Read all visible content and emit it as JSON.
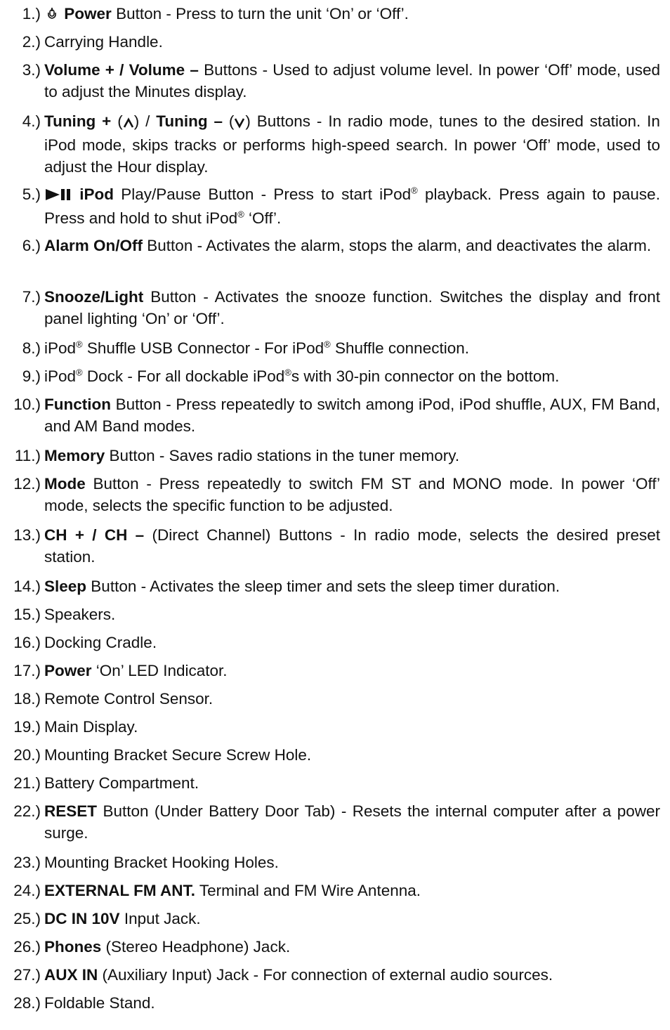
{
  "items": [
    {
      "num": "1.)",
      "bold": "Power",
      "text": "Button - Press to turn the unit ‘On’ or ‘Off’."
    },
    {
      "num": "2.)",
      "text": "Carrying Handle."
    },
    {
      "num": "3.)",
      "bold": "Volume + / Volume –",
      "text": "Buttons - Used to adjust volume level. In power ‘Off’ mode, used to adjust the Minutes display."
    },
    {
      "num": "4.)",
      "bold1": "Tuning +",
      "sym1": "(",
      "sym1b": ")",
      "sep": "/",
      "bold2": "Tuning –",
      "text": "Buttons - In radio mode, tunes to the desired station. In iPod mode, skips tracks or performs high-speed search. In power ‘Off’ mode, used to adjust the Hour display."
    },
    {
      "num": "5.)",
      "bold": "iPod",
      "pre": "Play/Pause Button - Press to start iPod",
      "mid": "playback. Press again to pause. Press and hold to shut iPod",
      "post": "‘Off’.",
      "reg": "®"
    },
    {
      "num": "6.)",
      "bold": "Alarm On/Off",
      "text": "Button - Activates the alarm, stops the alarm, and deactivates the alarm."
    },
    {
      "num": "7.)",
      "bold": "Snooze/Light",
      "text": "Button - Activates the snooze function. Switches the display and front panel lighting ‘On’ or ‘Off’."
    },
    {
      "num": "8.)",
      "pre": "iPod",
      "mid": "Shuffle USB Connector - For iPod",
      "post": "Shuffle connection.",
      "reg": "®"
    },
    {
      "num": "9.)",
      "pre": "iPod",
      "mid": "Dock - For all dockable iPod",
      "post": "s with 30-pin connector on the bottom.",
      "reg": "®"
    },
    {
      "num": "10.)",
      "bold": "Function",
      "text": "Button - Press repeatedly to switch among iPod, iPod shuffle, AUX, FM Band, and AM Band modes."
    },
    {
      "num": "11.)",
      "bold": "Memory",
      "text": "Button - Saves radio stations in the tuner memory."
    },
    {
      "num": "12.)",
      "bold": "Mode",
      "text": "Button - Press repeatedly to switch FM ST and MONO mode. In power ‘Off’ mode, selects the specific function to be adjusted."
    },
    {
      "num": "13.)",
      "bold": "CH + / CH –",
      "text": "(Direct Channel) Buttons - In radio mode, selects the desired preset station."
    },
    {
      "num": "14.)",
      "bold": "Sleep",
      "text": "Button - Activates the sleep timer and sets the sleep timer duration."
    },
    {
      "num": "15.)",
      "text": "Speakers."
    },
    {
      "num": "16.)",
      "text": "Docking Cradle."
    },
    {
      "num": "17.)",
      "bold": "Power",
      "text": "‘On’ LED Indicator."
    },
    {
      "num": "18.)",
      "text": "Remote Control Sensor."
    },
    {
      "num": "19.)",
      "text": "Main Display."
    },
    {
      "num": "20.)",
      "text": "Mounting Bracket Secure Screw Hole."
    },
    {
      "num": "21.)",
      "text": "Battery Compartment."
    },
    {
      "num": "22.)",
      "bold": "RESET",
      "text": "Button (Under Battery Door Tab) - Resets the internal computer after a power surge."
    },
    {
      "num": "23.)",
      "text": "Mounting Bracket Hooking Holes."
    },
    {
      "num": "24.)",
      "bold": "EXTERNAL FM ANT.",
      "text": "Terminal and FM Wire Antenna."
    },
    {
      "num": "25.)",
      "bold": "DC IN 10V",
      "text": "Input Jack."
    },
    {
      "num": "26.)",
      "bold": "Phones",
      "text": "(Stereo Headphone) Jack."
    },
    {
      "num": "27.)",
      "bold": "AUX IN",
      "text": "(Auxiliary Input) Jack - For connection of external audio sources."
    },
    {
      "num": "28.)",
      "text": "Foldable Stand."
    }
  ]
}
